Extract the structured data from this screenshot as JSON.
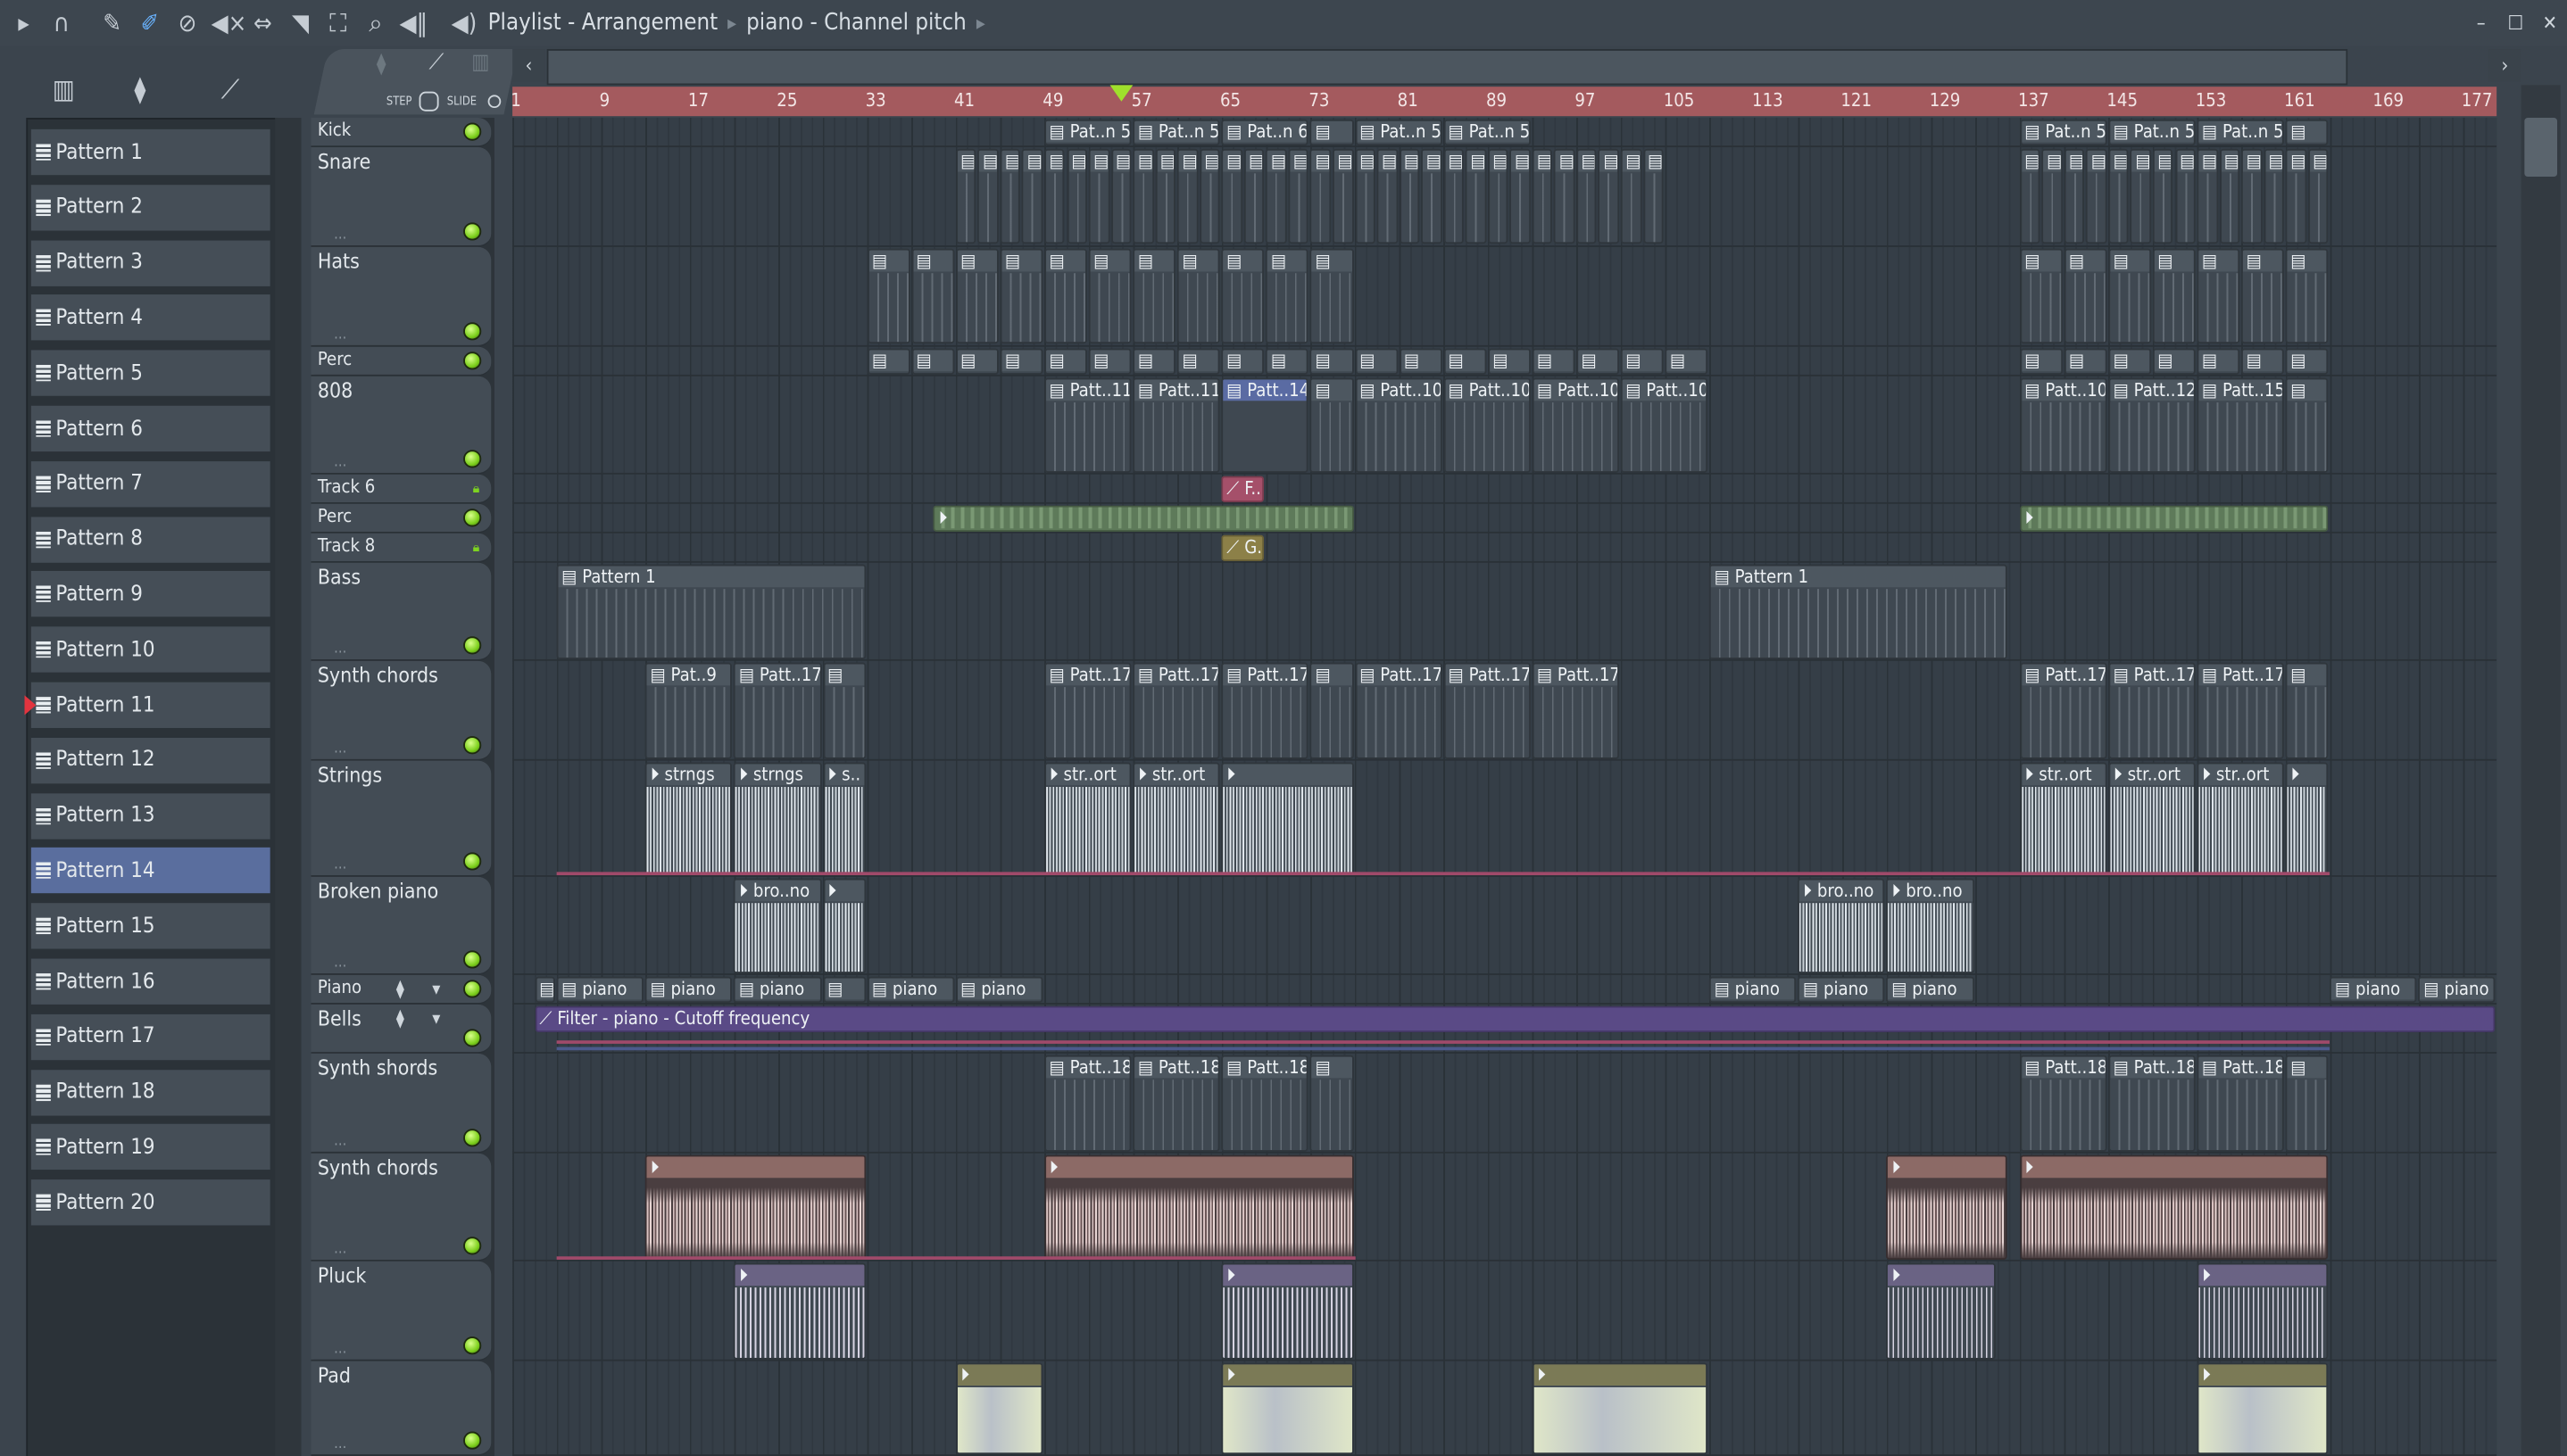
{
  "toolbar": {
    "title": "Playlist - Arrangement",
    "breadcrumb": "piano - Channel pitch",
    "icons": [
      "play-arrow-icon",
      "magnet-icon",
      "pencil-icon",
      "brush-icon",
      "delete-icon",
      "mute-icon",
      "slip-icon",
      "slice-icon",
      "select-icon",
      "zoom-icon",
      "playback-icon"
    ],
    "step_label": "STEP",
    "slide_label": "SLIDE"
  },
  "patterns": {
    "selected": "Pattern 14",
    "marked": "Pattern 11",
    "items": [
      "Pattern 1",
      "Pattern 2",
      "Pattern 3",
      "Pattern 4",
      "Pattern 5",
      "Pattern 6",
      "Pattern 7",
      "Pattern 8",
      "Pattern 9",
      "Pattern 10",
      "Pattern 11",
      "Pattern 12",
      "Pattern 13",
      "Pattern 14",
      "Pattern 15",
      "Pattern 16",
      "Pattern 17",
      "Pattern 18",
      "Pattern 19",
      "Pattern 20"
    ]
  },
  "ruler": {
    "ticks": [
      1,
      9,
      17,
      25,
      33,
      41,
      49,
      57,
      65,
      73,
      81,
      89,
      97,
      105,
      113,
      121,
      129,
      137,
      145,
      153,
      161,
      169,
      177
    ],
    "playhead_bar": 56
  },
  "tracks": [
    {
      "name": "Kick",
      "indicator": "led"
    },
    {
      "name": "Snare",
      "indicator": "led"
    },
    {
      "name": "Hats",
      "indicator": "led"
    },
    {
      "name": "Perc",
      "indicator": "led"
    },
    {
      "name": "808",
      "indicator": "led"
    },
    {
      "name": "Track 6",
      "indicator": "lock"
    },
    {
      "name": "Perc",
      "indicator": "led"
    },
    {
      "name": "Track 8",
      "indicator": "lock"
    },
    {
      "name": "Bass",
      "indicator": "led"
    },
    {
      "name": "Synth chords",
      "indicator": "led"
    },
    {
      "name": "Strings",
      "indicator": "led"
    },
    {
      "name": "Broken piano",
      "indicator": "led"
    },
    {
      "name": "Piano",
      "indicator": "led"
    },
    {
      "name": "Bells",
      "indicator": "led"
    },
    {
      "name": "Synth shords",
      "indicator": "led"
    },
    {
      "name": "Synth chords",
      "indicator": "led"
    },
    {
      "name": "Pluck",
      "indicator": "led"
    },
    {
      "name": "Pad",
      "indicator": "led"
    }
  ],
  "clips": [
    {
      "track": 0,
      "label": "Pat..n 5",
      "start": 49,
      "len": 8,
      "kind": "pattern"
    },
    {
      "track": 0,
      "label": "Pat..n 5",
      "start": 57,
      "len": 8,
      "kind": "pattern"
    },
    {
      "track": 0,
      "label": "Pat..n 6",
      "start": 65,
      "len": 8,
      "kind": "pattern"
    },
    {
      "track": 0,
      "label": "",
      "start": 73,
      "len": 4,
      "kind": "pattern"
    },
    {
      "track": 0,
      "label": "Pat..n 5",
      "start": 77,
      "len": 8,
      "kind": "pattern"
    },
    {
      "track": 0,
      "label": "Pat..n 5",
      "start": 85,
      "len": 8,
      "kind": "pattern"
    },
    {
      "track": 0,
      "label": "Pat..n 5",
      "start": 137,
      "len": 8,
      "kind": "pattern"
    },
    {
      "track": 0,
      "label": "Pat..n 5",
      "start": 145,
      "len": 8,
      "kind": "pattern"
    },
    {
      "track": 0,
      "label": "Pat..n 5",
      "start": 153,
      "len": 8,
      "kind": "pattern"
    },
    {
      "track": 0,
      "label": "",
      "start": 161,
      "len": 4,
      "kind": "pattern"
    },
    {
      "track": 1,
      "label": "",
      "start": 41,
      "len": 64,
      "kind": "pattern",
      "repeat": 2
    },
    {
      "track": 1,
      "label": "",
      "start": 137,
      "len": 28,
      "kind": "pattern",
      "repeat": 2
    },
    {
      "track": 2,
      "label": "",
      "start": 33,
      "len": 44,
      "kind": "pattern",
      "repeat": 4
    },
    {
      "track": 2,
      "label": "",
      "start": 137,
      "len": 28,
      "kind": "pattern",
      "repeat": 4
    },
    {
      "track": 3,
      "label": "",
      "start": 33,
      "len": 76,
      "kind": "pattern",
      "repeat": 4
    },
    {
      "track": 3,
      "label": "",
      "start": 137,
      "len": 28,
      "kind": "pattern",
      "repeat": 4
    },
    {
      "track": 4,
      "label": "Patt..11",
      "start": 49,
      "len": 8,
      "kind": "pattern"
    },
    {
      "track": 4,
      "label": "Patt..11",
      "start": 57,
      "len": 8,
      "kind": "pattern"
    },
    {
      "track": 4,
      "label": "Patt..14",
      "start": 65,
      "len": 8,
      "kind": "sel"
    },
    {
      "track": 4,
      "label": "",
      "start": 73,
      "len": 4,
      "kind": "pattern"
    },
    {
      "track": 4,
      "label": "Patt..10",
      "start": 77,
      "len": 8,
      "kind": "pattern"
    },
    {
      "track": 4,
      "label": "Patt..10",
      "start": 85,
      "len": 8,
      "kind": "pattern"
    },
    {
      "track": 4,
      "label": "Patt..10",
      "start": 93,
      "len": 8,
      "kind": "pattern"
    },
    {
      "track": 4,
      "label": "Patt..10",
      "start": 101,
      "len": 8,
      "kind": "pattern"
    },
    {
      "track": 4,
      "label": "Patt..10",
      "start": 137,
      "len": 8,
      "kind": "pattern"
    },
    {
      "track": 4,
      "label": "Patt..12",
      "start": 145,
      "len": 8,
      "kind": "pattern"
    },
    {
      "track": 4,
      "label": "Patt..15",
      "start": 153,
      "len": 8,
      "kind": "pattern"
    },
    {
      "track": 4,
      "label": "",
      "start": 161,
      "len": 4,
      "kind": "pattern"
    },
    {
      "track": 5,
      "label": "F..",
      "start": 65,
      "len": 4,
      "kind": "auto-pink"
    },
    {
      "track": 6,
      "label": "",
      "start": 39,
      "len": 38,
      "kind": "audio-green"
    },
    {
      "track": 6,
      "label": "",
      "start": 137,
      "len": 28,
      "kind": "audio-green"
    },
    {
      "track": 7,
      "label": "G..",
      "start": 65,
      "len": 4,
      "kind": "auto-olive"
    },
    {
      "track": 8,
      "label": "Pattern 1",
      "start": 5,
      "len": 28,
      "kind": "pattern"
    },
    {
      "track": 8,
      "label": "Pattern 1",
      "start": 109,
      "len": 27,
      "kind": "pattern"
    },
    {
      "track": 9,
      "label": "Pat..9",
      "start": 13,
      "len": 8,
      "kind": "pattern"
    },
    {
      "track": 9,
      "label": "Patt..17",
      "start": 21,
      "len": 8,
      "kind": "pattern"
    },
    {
      "track": 9,
      "label": "",
      "start": 29,
      "len": 4,
      "kind": "pattern"
    },
    {
      "track": 9,
      "label": "Patt..17",
      "start": 49,
      "len": 8,
      "kind": "pattern"
    },
    {
      "track": 9,
      "label": "Patt..17",
      "start": 57,
      "len": 8,
      "kind": "pattern"
    },
    {
      "track": 9,
      "label": "Patt..17",
      "start": 65,
      "len": 8,
      "kind": "pattern"
    },
    {
      "track": 9,
      "label": "",
      "start": 73,
      "len": 4,
      "kind": "pattern"
    },
    {
      "track": 9,
      "label": "Patt..17",
      "start": 77,
      "len": 8,
      "kind": "pattern"
    },
    {
      "track": 9,
      "label": "Patt..17",
      "start": 85,
      "len": 8,
      "kind": "pattern"
    },
    {
      "track": 9,
      "label": "Patt..17",
      "start": 93,
      "len": 8,
      "kind": "pattern"
    },
    {
      "track": 9,
      "label": "Patt..17",
      "start": 137,
      "len": 8,
      "kind": "pattern"
    },
    {
      "track": 9,
      "label": "Patt..17",
      "start": 145,
      "len": 8,
      "kind": "pattern"
    },
    {
      "track": 9,
      "label": "Patt..17",
      "start": 153,
      "len": 8,
      "kind": "pattern"
    },
    {
      "track": 9,
      "label": "",
      "start": 161,
      "len": 4,
      "kind": "pattern"
    },
    {
      "track": 10,
      "label": "strngs",
      "start": 13,
      "len": 8,
      "kind": "audio-str"
    },
    {
      "track": 10,
      "label": "strngs",
      "start": 21,
      "len": 8,
      "kind": "audio-str"
    },
    {
      "track": 10,
      "label": "s..",
      "start": 29,
      "len": 4,
      "kind": "audio-str"
    },
    {
      "track": 10,
      "label": "str..ort",
      "start": 49,
      "len": 8,
      "kind": "audio-str"
    },
    {
      "track": 10,
      "label": "str..ort",
      "start": 57,
      "len": 8,
      "kind": "audio-str"
    },
    {
      "track": 10,
      "label": "",
      "start": 65,
      "len": 12,
      "kind": "audio-str"
    },
    {
      "track": 10,
      "label": "str..ort",
      "start": 137,
      "len": 8,
      "kind": "audio-str"
    },
    {
      "track": 10,
      "label": "str..ort",
      "start": 145,
      "len": 8,
      "kind": "audio-str"
    },
    {
      "track": 10,
      "label": "str..ort",
      "start": 153,
      "len": 8,
      "kind": "audio-str"
    },
    {
      "track": 10,
      "label": "",
      "start": 161,
      "len": 4,
      "kind": "audio-str"
    },
    {
      "track": 11,
      "label": "bro..no",
      "start": 21,
      "len": 8,
      "kind": "audio-str"
    },
    {
      "track": 11,
      "label": "",
      "start": 29,
      "len": 4,
      "kind": "audio-str"
    },
    {
      "track": 11,
      "label": "bro..no",
      "start": 117,
      "len": 8,
      "kind": "audio-str"
    },
    {
      "track": 11,
      "label": "bro..no",
      "start": 125,
      "len": 8,
      "kind": "audio-str"
    },
    {
      "track": 12,
      "label": "",
      "start": 3,
      "len": 2,
      "kind": "pattern"
    },
    {
      "track": 12,
      "label": "piano",
      "start": 5,
      "len": 8,
      "kind": "pattern"
    },
    {
      "track": 12,
      "label": "piano",
      "start": 13,
      "len": 8,
      "kind": "pattern"
    },
    {
      "track": 12,
      "label": "piano",
      "start": 21,
      "len": 8,
      "kind": "pattern"
    },
    {
      "track": 12,
      "label": "",
      "start": 29,
      "len": 4,
      "kind": "pattern"
    },
    {
      "track": 12,
      "label": "piano",
      "start": 33,
      "len": 8,
      "kind": "pattern"
    },
    {
      "track": 12,
      "label": "piano",
      "start": 41,
      "len": 8,
      "kind": "pattern"
    },
    {
      "track": 12,
      "label": "piano",
      "start": 109,
      "len": 8,
      "kind": "pattern"
    },
    {
      "track": 12,
      "label": "piano",
      "start": 117,
      "len": 8,
      "kind": "pattern"
    },
    {
      "track": 12,
      "label": "piano",
      "start": 125,
      "len": 8,
      "kind": "pattern"
    },
    {
      "track": 12,
      "label": "piano",
      "start": 165,
      "len": 8,
      "kind": "pattern"
    },
    {
      "track": 12,
      "label": "piano",
      "start": 173,
      "len": 7,
      "kind": "pattern"
    },
    {
      "track": 13,
      "label": "Filter - piano - Cutoff frequency",
      "start": 3,
      "len": 177,
      "kind": "auto-purple"
    },
    {
      "track": 14,
      "label": "Patt..18",
      "start": 49,
      "len": 8,
      "kind": "pattern"
    },
    {
      "track": 14,
      "label": "Patt..18",
      "start": 57,
      "len": 8,
      "kind": "pattern"
    },
    {
      "track": 14,
      "label": "Patt..18",
      "start": 65,
      "len": 8,
      "kind": "pattern"
    },
    {
      "track": 14,
      "label": "",
      "start": 73,
      "len": 4,
      "kind": "pattern"
    },
    {
      "track": 14,
      "label": "Patt..18",
      "start": 137,
      "len": 8,
      "kind": "pattern"
    },
    {
      "track": 14,
      "label": "Patt..18",
      "start": 145,
      "len": 8,
      "kind": "pattern"
    },
    {
      "track": 14,
      "label": "Patt..18",
      "start": 153,
      "len": 8,
      "kind": "pattern"
    },
    {
      "track": 14,
      "label": "",
      "start": 161,
      "len": 4,
      "kind": "pattern"
    },
    {
      "track": 15,
      "label": "",
      "start": 13,
      "len": 20,
      "kind": "audio-brown"
    },
    {
      "track": 15,
      "label": "",
      "start": 49,
      "len": 28,
      "kind": "audio-brown"
    },
    {
      "track": 15,
      "label": "",
      "start": 125,
      "len": 11,
      "kind": "audio-brown"
    },
    {
      "track": 15,
      "label": "",
      "start": 137,
      "len": 28,
      "kind": "audio-brown"
    },
    {
      "track": 16,
      "label": "",
      "start": 21,
      "len": 12,
      "kind": "pluck"
    },
    {
      "track": 16,
      "label": "",
      "start": 65,
      "len": 12,
      "kind": "pluck"
    },
    {
      "track": 16,
      "label": "",
      "start": 125,
      "len": 10,
      "kind": "pluck"
    },
    {
      "track": 16,
      "label": "",
      "start": 153,
      "len": 12,
      "kind": "pluck"
    },
    {
      "track": 17,
      "label": "",
      "start": 41,
      "len": 8,
      "kind": "pad"
    },
    {
      "track": 17,
      "label": "",
      "start": 65,
      "len": 12,
      "kind": "pad"
    },
    {
      "track": 17,
      "label": "",
      "start": 93,
      "len": 16,
      "kind": "pad"
    },
    {
      "track": 17,
      "label": "",
      "start": 153,
      "len": 12,
      "kind": "pad"
    }
  ]
}
